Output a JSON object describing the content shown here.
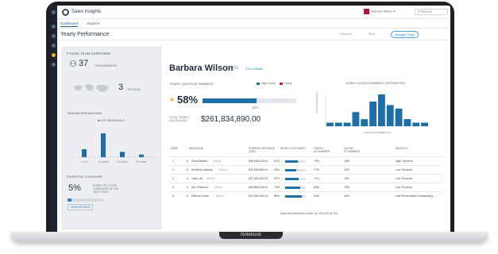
{
  "app": {
    "title": "Sales Insights"
  },
  "top_tabs": [
    "Dashboard",
    "Explore"
  ],
  "user": {
    "name": "Barbara Wilson"
  },
  "period_select": "FY2021",
  "page": {
    "title": "Yearly Performance",
    "actions": [
      "Check-In",
      "Print",
      "Manage Team"
    ]
  },
  "team_panel": {
    "title": "FY2021 TEAM OVERVIEW",
    "team_count": "37",
    "team_count_label": "TEAM MEMBERS",
    "regions": "3",
    "regions_label": "REGIONS",
    "tenure_label": "TENURE BREAKDOWN",
    "tenure_legend": "# OF INDIVIDUALS",
    "tenure_buckets": [
      {
        "label": "< 1 yr",
        "value": 3
      },
      {
        "label": "1-3 Years",
        "value": 9
      },
      {
        "label": "3-5 Years",
        "value": 2
      },
      {
        "label": "5+ Years",
        "value": 1
      }
    ],
    "turnover_label": "EXPECTED TURNOVER",
    "turnover_value": "5%",
    "turnover_note": "EXPECTED TO BE TURNOVER IN THE NEXT YEAR",
    "turnover_fraction": 0.1,
    "turnover_link": "VIEW DETAILS"
  },
  "rep": {
    "name": "Barbara Wilson",
    "id": "(6052)",
    "details_link": "View Details",
    "quota_label": "YEARLY QUOTA ATTAINMENT",
    "legend": [
      {
        "label": "High Quota",
        "color": "#1e6fa8"
      },
      {
        "label": "Yearly",
        "color": "#c2185b"
      }
    ],
    "attainment": "58%",
    "attainment_fraction": 0.58,
    "attainment_marker": "80%",
    "quota_value_label": "TOTAL YEARLY QUOTA (USD)",
    "quota_value": "$261,834,890.00"
  },
  "distribution": {
    "title": "YEARLY QUOTA ATTAINMENT DISTRIBUTION",
    "ylabel": "# OF INDIVIDUALS",
    "xlabel": "QUOTA ATTAINMENT (%)",
    "values": [
      1,
      1,
      1,
      4,
      2,
      7,
      9,
      6,
      5,
      2,
      1,
      1
    ]
  },
  "table": {
    "headers": [
      "RANK",
      "INDIVIDUAL",
      "CURRENT REVENUE (USD)",
      "RESULTS ATTAINED",
      "YEARLY ATTAINMENT",
      "QUOTA ATTAINMENT",
      "INSIGHTS"
    ],
    "rows": [
      {
        "rank": "1",
        "name": "Chris Walker",
        "id": "(4413)",
        "revenue": "$48,638,423.00",
        "pct": "61%",
        "bar": 0.61,
        "yearly": "70%",
        "growth": "18%",
        "insight": "High Turnover"
      },
      {
        "rank": "2",
        "name": "Kimberly Lalonde",
        "id": "(5411)",
        "revenue": "$30,950,882.00",
        "pct": "52%",
        "bar": 0.52,
        "yearly": "77%",
        "growth": "22%",
        "insight": "Low Turnover"
      },
      {
        "rank": "3",
        "name": "Jake Lee",
        "id": "(6024)",
        "revenue": "$27,562,932.00",
        "pct": "67%",
        "bar": 0.67,
        "yearly": "71%",
        "growth": "15%",
        "insight": "Low Turnover"
      },
      {
        "rank": "4",
        "name": "Eric Peterson",
        "id": "(5011)",
        "revenue": "$26,883,094.00",
        "pct": "73%",
        "bar": 0.73,
        "yearly": "83%",
        "growth": "78%",
        "insight": "Low Turnover"
      },
      {
        "rank": "5",
        "name": "Patricia Jones",
        "id": "(6047)",
        "revenue": "$24,593,391.00",
        "pct": "80%",
        "bar": 0.8,
        "yearly": "94%",
        "growth": "62%",
        "insight": "Has Performance Outstanding"
      }
    ]
  },
  "footnote": "Data last refreshed on Mar 15, 2019 00:00 PM",
  "laptop_label": "Notebook"
}
